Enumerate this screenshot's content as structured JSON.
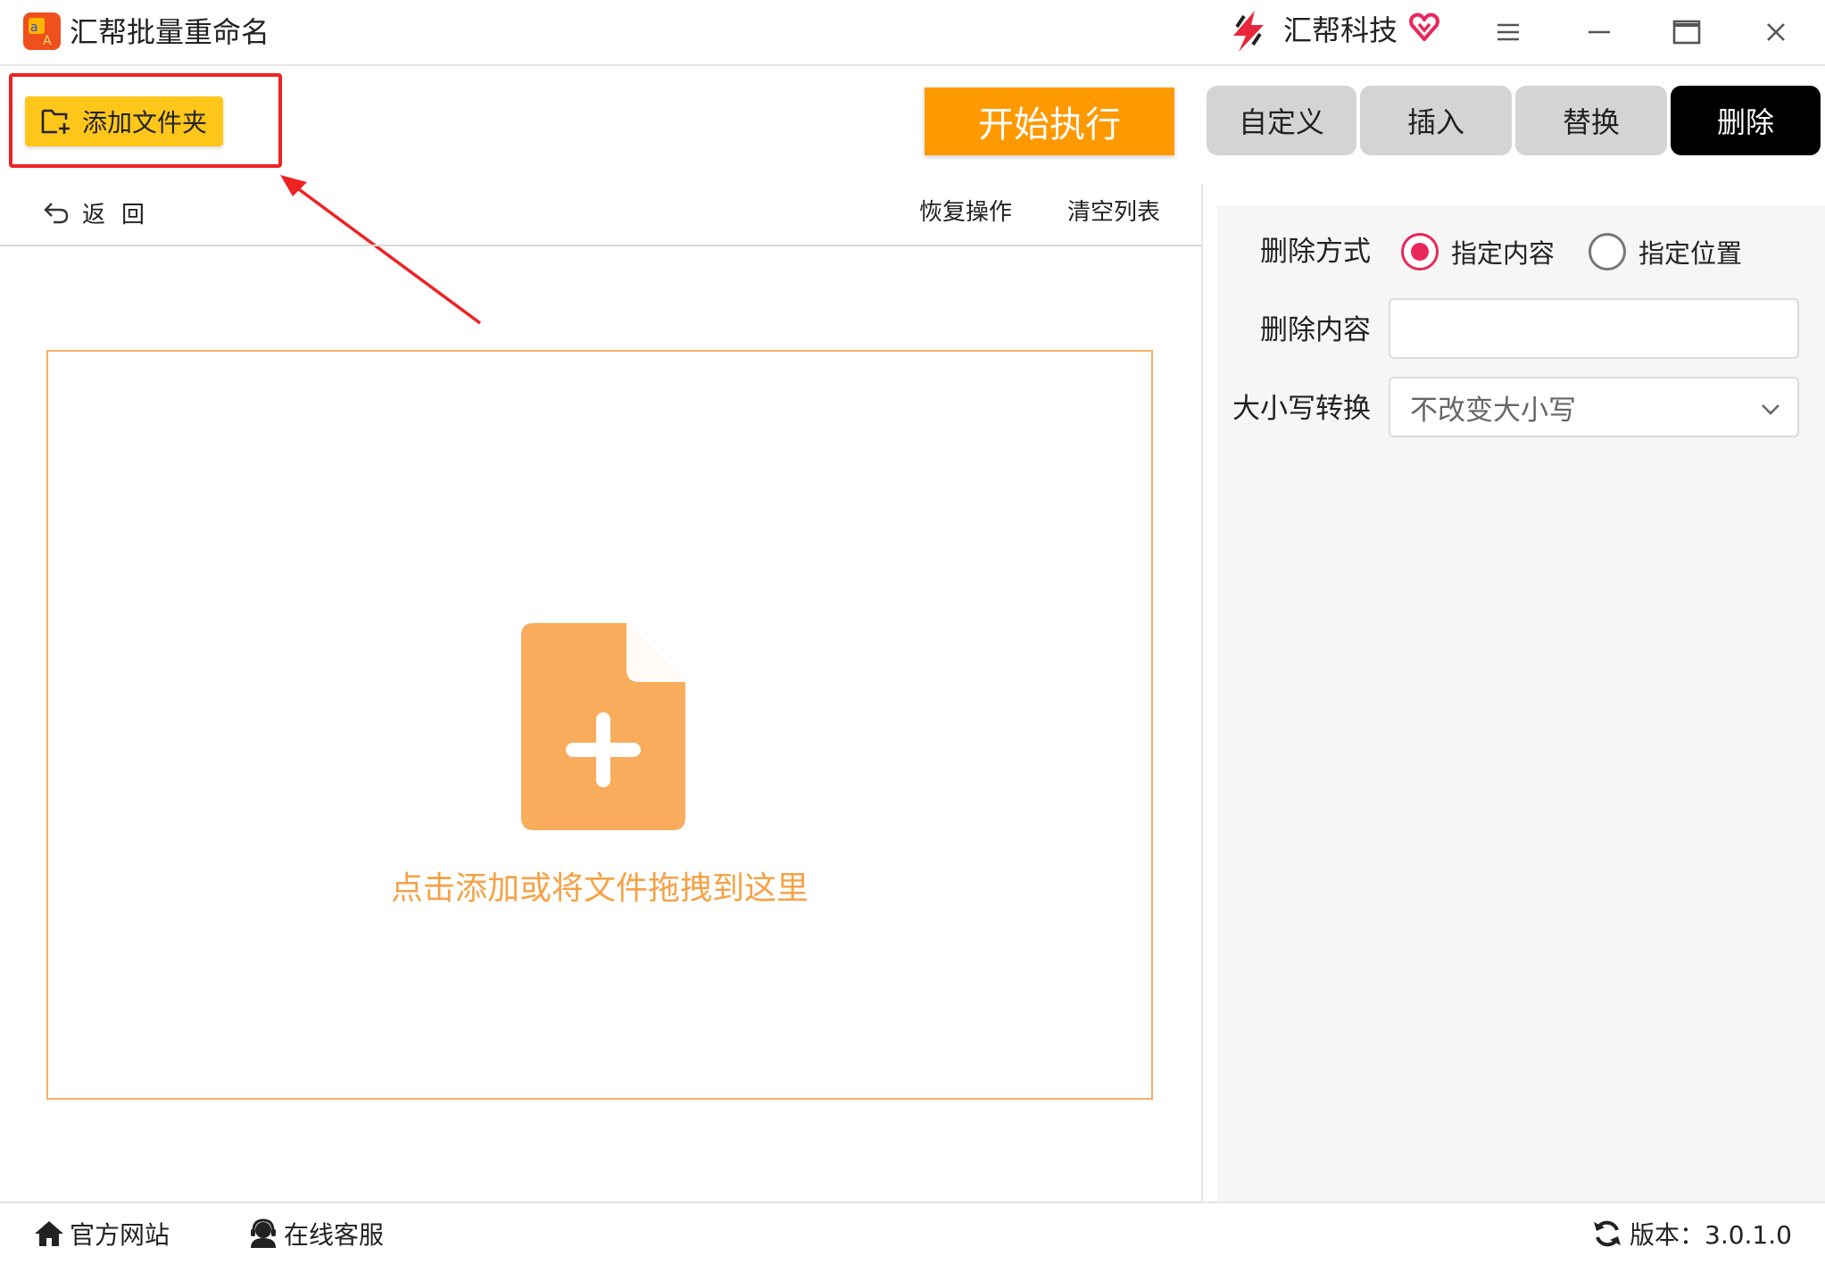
{
  "window": {
    "app_title": "汇帮批量重命名",
    "brand_name": "汇帮科技"
  },
  "toolbar": {
    "add_folder_label": "添加文件夹",
    "start_label": "开始执行",
    "tabs": [
      {
        "label": "自定义",
        "active": false
      },
      {
        "label": "插入",
        "active": false
      },
      {
        "label": "替换",
        "active": false
      },
      {
        "label": "删除",
        "active": true
      }
    ]
  },
  "list_toolbar": {
    "back_label": "返回",
    "undo_label": "恢复操作",
    "clear_label": "清空列表"
  },
  "dropzone": {
    "hint": "点击添加或将文件拖拽到这里"
  },
  "panel": {
    "mode_label": "删除方式",
    "mode_options": [
      {
        "label": "指定内容",
        "selected": true
      },
      {
        "label": "指定位置",
        "selected": false
      }
    ],
    "content_label": "删除内容",
    "content_value": "",
    "case_label": "大小写转换",
    "case_value": "不改变大小写"
  },
  "statusbar": {
    "site_label": "官方网站",
    "support_label": "在线客服",
    "version_text": "版本：3.0.1.0"
  },
  "colors": {
    "accent_orange": "#ff9900",
    "button_yellow": "#ffc61a",
    "dropzone_border": "#f8b064",
    "dropzone_icon": "#f8ac5c",
    "radio_selected": "#e8275b",
    "highlight_red": "#ee2222",
    "active_tab": "#000000"
  }
}
